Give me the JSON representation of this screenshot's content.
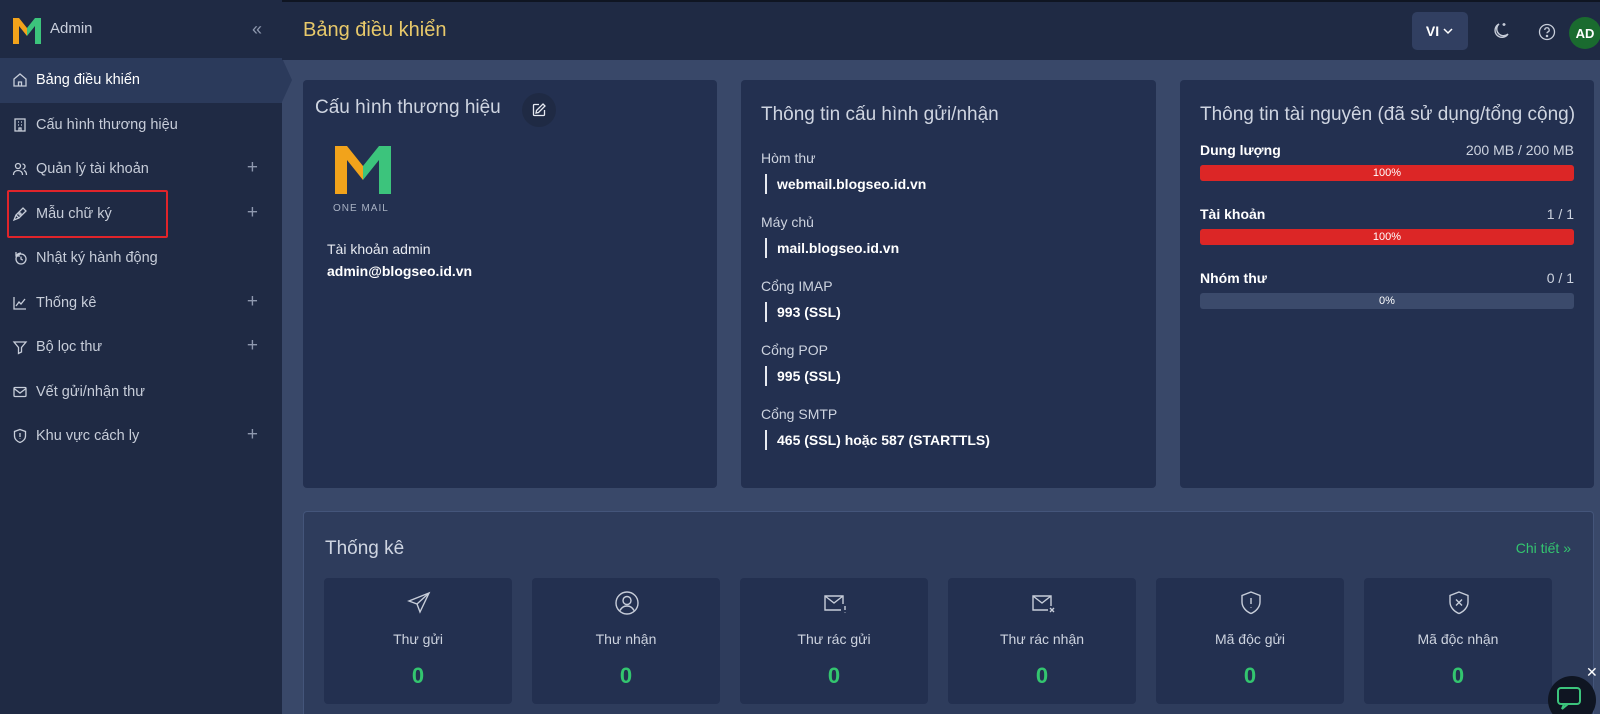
{
  "sidebar": {
    "brand_name": "Admin",
    "items": [
      {
        "label": "Bảng điều khiển",
        "icon": "home-icon",
        "expandable": false
      },
      {
        "label": "Cấu hình thương hiệu",
        "icon": "building-icon",
        "expandable": false
      },
      {
        "label": "Quản lý tài khoản",
        "icon": "users-icon",
        "expandable": true
      },
      {
        "label": "Mẫu chữ ký",
        "icon": "pen-icon",
        "expandable": true
      },
      {
        "label": "Nhật ký hành động",
        "icon": "history-icon",
        "expandable": false
      },
      {
        "label": "Thống kê",
        "icon": "chart-icon",
        "expandable": true
      },
      {
        "label": "Bộ lọc thư",
        "icon": "filter-icon",
        "expandable": true
      },
      {
        "label": "Vết gửi/nhận thư",
        "icon": "mail-icon",
        "expandable": false
      },
      {
        "label": "Khu vực cách ly",
        "icon": "shield-icon",
        "expandable": true
      }
    ],
    "expand_symbol": "+"
  },
  "header": {
    "title": "Bảng điều khiển",
    "lang": "VI",
    "avatar_initials": "AD"
  },
  "brand_card": {
    "title": "Cấu hình thương hiệu",
    "logo_caption": "ONE MAIL",
    "account_label": "Tài khoản admin",
    "account_value": "admin@blogseo.id.vn"
  },
  "config_card": {
    "title": "Thông tin cấu hình gửi/nhận",
    "items": [
      {
        "label": "Hòm thư",
        "value": "webmail.blogseo.id.vn"
      },
      {
        "label": "Máy chủ",
        "value": "mail.blogseo.id.vn"
      },
      {
        "label": "Cổng IMAP",
        "value": "993 (SSL)"
      },
      {
        "label": "Cổng POP",
        "value": "995 (SSL)"
      },
      {
        "label": "Cổng SMTP",
        "value": "465 (SSL) hoặc 587 (STARTTLS)"
      }
    ]
  },
  "resource_card": {
    "title": "Thông tin tài nguyên (đã sử dụng/tổng cộng)",
    "items": [
      {
        "name": "Dung lượng",
        "value": "200 MB / 200 MB",
        "percent_label": "100%",
        "percent": 100
      },
      {
        "name": "Tài khoản",
        "value": "1 / 1",
        "percent_label": "100%",
        "percent": 100
      },
      {
        "name": "Nhóm thư",
        "value": "0 / 1",
        "percent_label": "0%",
        "percent": 0
      }
    ],
    "bar_color": "#dc2626"
  },
  "stats": {
    "title": "Thống kê",
    "detail_link": "Chi tiết »",
    "tiles": [
      {
        "label": "Thư gửi",
        "value": "0",
        "icon": "send-icon"
      },
      {
        "label": "Thư nhận",
        "value": "0",
        "icon": "user-circle-icon"
      },
      {
        "label": "Thư rác gửi",
        "value": "0",
        "icon": "mail-alert-icon"
      },
      {
        "label": "Thư rác nhận",
        "value": "0",
        "icon": "mail-x-icon"
      },
      {
        "label": "Mã độc gửi",
        "value": "0",
        "icon": "shield-alert-icon"
      },
      {
        "label": "Mã độc nhận",
        "value": "0",
        "icon": "shield-x-icon"
      }
    ],
    "value_color": "#33c56f"
  }
}
